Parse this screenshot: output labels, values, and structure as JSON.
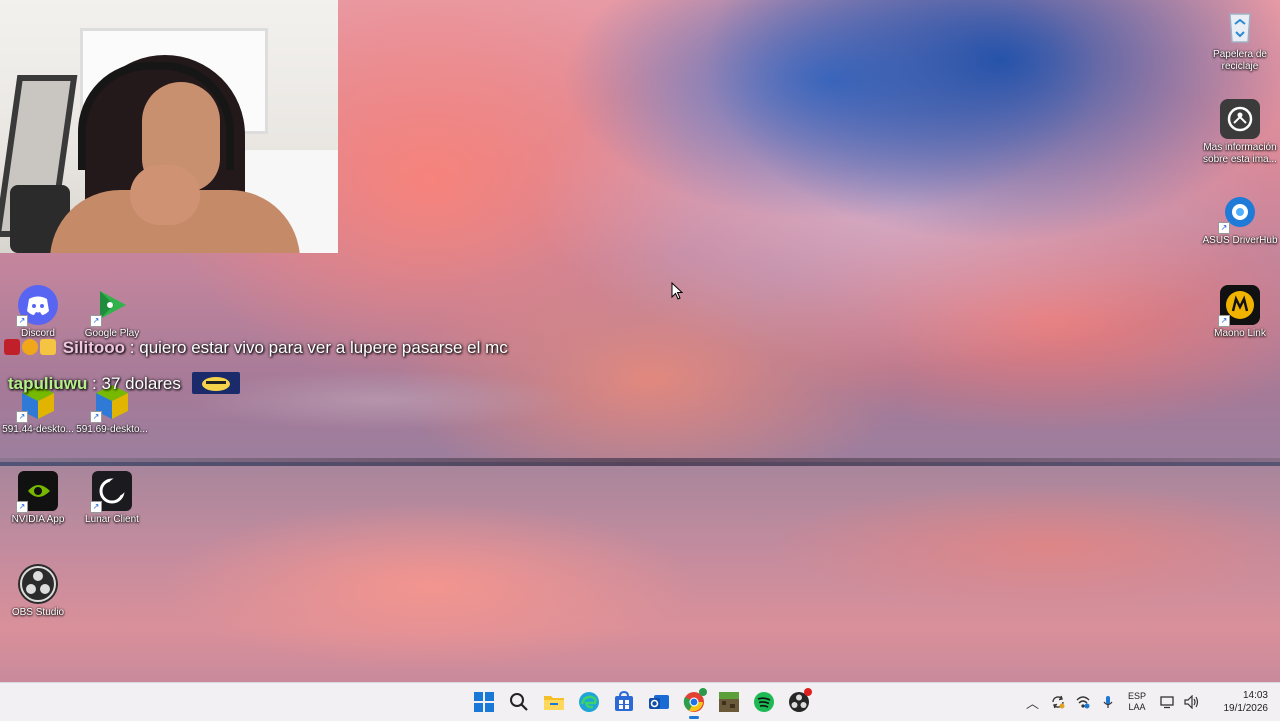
{
  "desktop_icons": [
    {
      "name": "Discord"
    },
    {
      "name": "Google Play"
    },
    {
      "name": "591.44-deskto..."
    },
    {
      "name": "591.69-deskto..."
    },
    {
      "name": "NVIDIA App"
    },
    {
      "name": "Lunar Client"
    },
    {
      "name": "OBS Studio"
    },
    {
      "name": "Papelera de reciclaje"
    },
    {
      "name": "Mas información sobre esta ima..."
    },
    {
      "name": "ASUS DriverHub"
    },
    {
      "name": "Maono Link"
    }
  ],
  "chat": [
    {
      "user": "Silitooo",
      "sep": " : ",
      "message": "quiero estar vivo para ver a lupere pasarse el mc"
    },
    {
      "user": "tapuliuwu",
      "sep": " : ",
      "message": "37 dolares"
    }
  ],
  "taskbar": {
    "apps": [
      "start-icon",
      "search-icon",
      "file-explorer-icon",
      "edge-icon",
      "store-icon",
      "outlook-icon",
      "chrome-icon",
      "minecraft-icon",
      "spotify-icon",
      "obs-icon"
    ],
    "lang_line1": "ESP",
    "lang_line2": "LAA",
    "time": "14:03",
    "date": "19/1/2026"
  },
  "colors": {
    "taskbar_bg": "#f2f0f3",
    "discord": "#5865f2",
    "nvidia": "#76b900",
    "spotify": "#1db954",
    "chat_user": "#b6f08a"
  }
}
